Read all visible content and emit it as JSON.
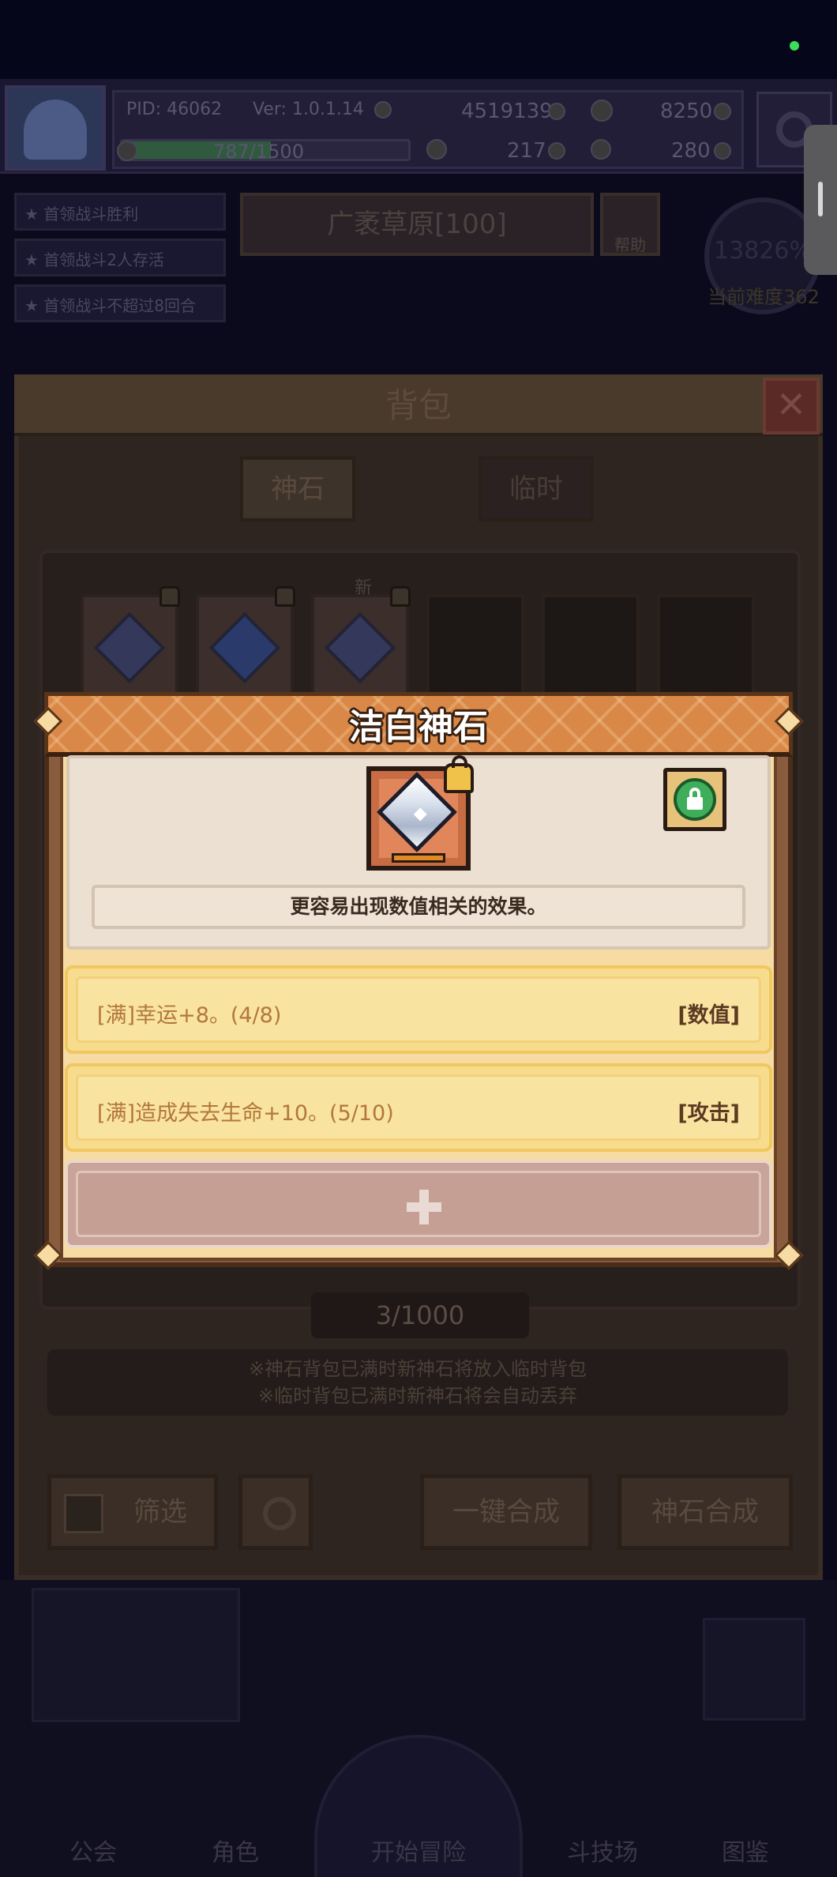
{
  "topbar": {
    "pid": "PID: 46062",
    "version": "Ver: 1.0.1.14",
    "gold": "4519139",
    "gems": "8250",
    "exp": "787/1500",
    "clover": "217",
    "boot": "280"
  },
  "quests": [
    "首领战斗胜利",
    "首领战斗2人存活",
    "首领战斗不超过8回合"
  ],
  "stage": {
    "name": "广袤草原[100]",
    "help": "帮助"
  },
  "stopwatch": {
    "percent": "13826%",
    "difficulty": "当前难度362"
  },
  "backpack": {
    "title": "背包",
    "close": "✕",
    "tabs": [
      "神石",
      "临时"
    ],
    "new_badge": "新",
    "counter": "3/1000",
    "notice_line1": "※神石背包已满时新神石将放入临时背包",
    "notice_line2": "※临时背包已满时新神石将会自动丢弃",
    "filter": "筛选",
    "merge_all": "一键合成",
    "merge": "神石合成"
  },
  "modal": {
    "title": "洁白神石",
    "description": "更容易出现数值相关的效果。",
    "effects": [
      {
        "text": "[满]幸运+8。(4/8)",
        "tag": "[数值]"
      },
      {
        "text": "[满]造成失去生命+10。(5/10)",
        "tag": "[攻击]"
      }
    ],
    "add_icon": "plus-icon"
  },
  "nav": [
    "公会",
    "角色",
    "开始冒险",
    "斗技场",
    "图鉴"
  ],
  "colors": {
    "modal_header": "#d98848",
    "effect_bg": "#f8dc8e",
    "effect_text": "#b2773a",
    "lock_green": "#3fae5a"
  }
}
